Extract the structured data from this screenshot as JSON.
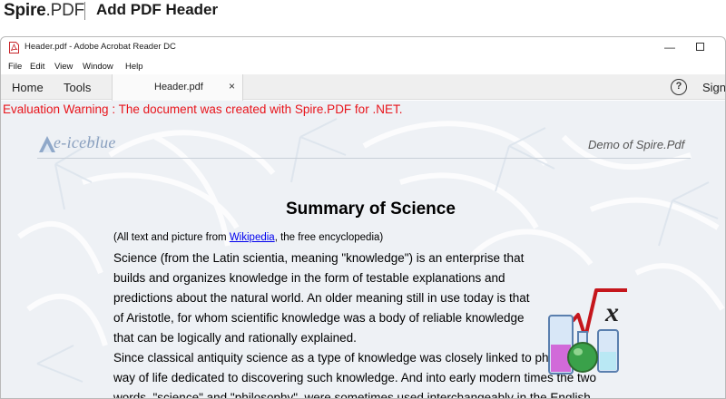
{
  "banner": {
    "brand_bold": "Spire",
    "brand_rest": ".PDF",
    "title": "Add PDF Header"
  },
  "window": {
    "title": "Header.pdf - Adobe Acrobat Reader DC",
    "minimize_glyph": "—",
    "menu": [
      "File",
      "Edit",
      "View",
      "Window",
      "Help"
    ]
  },
  "toolbar": {
    "home": "Home",
    "tools": "Tools",
    "tab_label": "Header.pdf",
    "tab_close": "×",
    "help_glyph": "?",
    "sign": "Sign"
  },
  "document": {
    "evaluation_warning": "Evaluation Warning : The document was created with Spire.PDF for .NET.",
    "header_logo_text": "e-iceblue",
    "header_right": "Demo of Spire.Pdf",
    "title": "Summary of Science",
    "credit_before": "(All text and picture from ",
    "credit_link": "Wikipedia",
    "credit_after": ", the free encyclopedia)",
    "body_lines": [
      "Science (from the Latin scientia, meaning \"knowledge\") is an enterprise that",
      "builds and organizes knowledge in the form of testable explanations and",
      "predictions about the natural world. An older meaning still in use today is that",
      "of Aristotle, for whom scientific knowledge was a body of reliable knowledge",
      "that can be logically and rationally explained.",
      "Since classical antiquity science as a type of knowledge was closely linked to philosophy, the",
      "way of life dedicated to discovering such knowledge. And into early modern times the two",
      "words, \"science\" and \"philosophy\", were sometimes used interchangeably in the English"
    ]
  },
  "colors": {
    "warning": "#e8141b",
    "link": "#0000ee",
    "toolbar_bg": "#efefef"
  },
  "icons": {
    "pdf": "pdf-file-icon",
    "help": "help-circle-icon",
    "logo": "iceblue-logo-icon",
    "science": "science-flask-icon"
  }
}
